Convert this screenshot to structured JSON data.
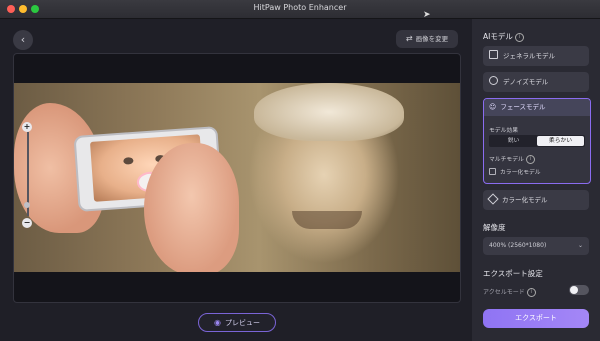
{
  "window": {
    "title": "HitPaw Photo Enhancer"
  },
  "toolbar": {
    "change_image_label": "画像を変更"
  },
  "preview": {
    "label": "プレビュー"
  },
  "sidebar": {
    "ai_model_title": "AIモデル",
    "models": {
      "general": "ジェネラルモデル",
      "denoise": "デノイズモデル",
      "face": "フェースモデル",
      "colorize": "カラー化モデル"
    },
    "face_options": {
      "effect_label": "モデル効果",
      "sharp": "鋭い",
      "soft": "柔らかい",
      "selected": "柔らかい",
      "multi_label": "マルチモデル",
      "colorize_checkbox": "カラー化モデル",
      "colorize_checked": false
    },
    "resolution": {
      "title": "解像度",
      "value": "400% (2560*1080)"
    },
    "export": {
      "title": "エクスポート設定",
      "accel_label": "アクセルモード",
      "accel_on": false,
      "button": "エクスポート"
    }
  },
  "colors": {
    "accent": "#8a6cf0",
    "background": "#1f1f27",
    "sidebar": "#2a2a33"
  },
  "icons": [
    "back-arrow-icon",
    "swap-icon",
    "eye-icon",
    "zoom-in-icon",
    "zoom-out-icon",
    "image-icon",
    "denoise-icon",
    "face-icon",
    "colorize-icon",
    "info-icon",
    "chevron-down-icon"
  ]
}
